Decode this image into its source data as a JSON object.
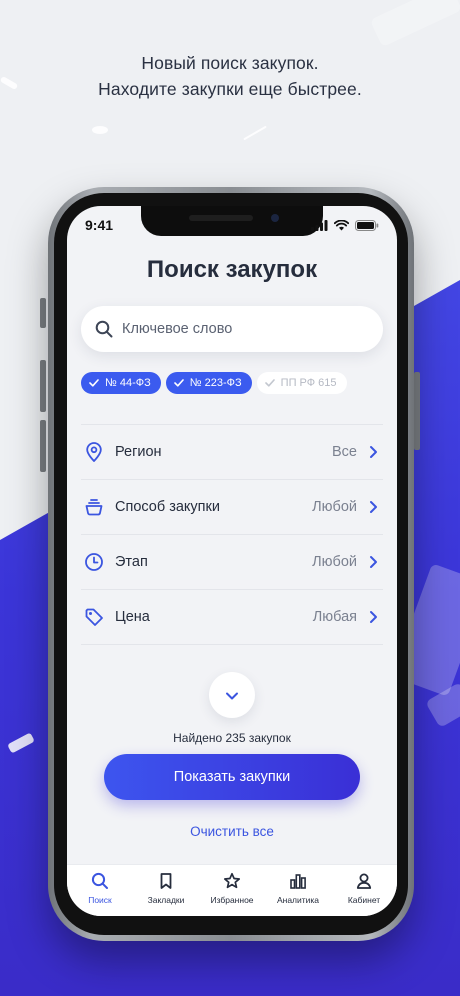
{
  "promo": {
    "line1": "Новый поиск закупок.",
    "line2": "Находите закупки еще быстрее."
  },
  "status_bar": {
    "time": "9:41"
  },
  "page": {
    "title": "Поиск закупок"
  },
  "search": {
    "placeholder": "Ключевое слово",
    "value": ""
  },
  "chips": [
    {
      "label": "№ 44-ФЗ",
      "selected": true
    },
    {
      "label": "№ 223-ФЗ",
      "selected": true
    },
    {
      "label": "ПП РФ 615",
      "selected": false
    }
  ],
  "filters": [
    {
      "label": "Регион",
      "value": "Все",
      "icon": "location-pin-icon"
    },
    {
      "label": "Способ закупки",
      "value": "Любой",
      "icon": "purchase-method-icon"
    },
    {
      "label": "Этап",
      "value": "Любой",
      "icon": "clock-icon"
    },
    {
      "label": "Цена",
      "value": "Любая",
      "icon": "price-tag-icon"
    }
  ],
  "results": {
    "found_text": "Найдено 235 закупок"
  },
  "actions": {
    "show_label": "Показать закупки",
    "clear_label": "Очистить все"
  },
  "tabbar": [
    {
      "label": "Поиск",
      "icon": "search-icon",
      "active": true
    },
    {
      "label": "Закладки",
      "icon": "bookmark-icon",
      "active": false
    },
    {
      "label": "Избранное",
      "icon": "star-icon",
      "active": false
    },
    {
      "label": "Аналитика",
      "icon": "bar-chart-icon",
      "active": false
    },
    {
      "label": "Кабинет",
      "icon": "user-icon",
      "active": false
    }
  ],
  "colors": {
    "accent": "#3b55e0",
    "button_gradient": [
      "#3d55ef",
      "#3a2fd6"
    ],
    "background_blue": "#4a55ee",
    "text_dark": "#262d3d"
  }
}
